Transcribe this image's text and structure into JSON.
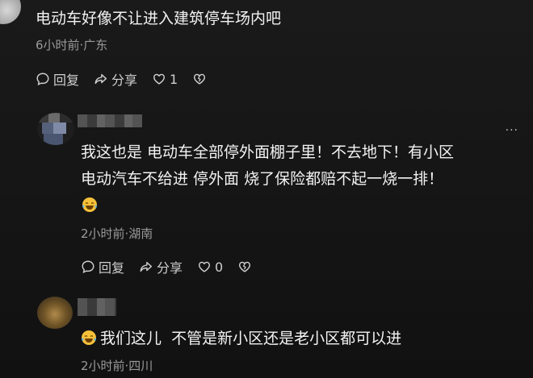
{
  "comment": {
    "text": "电动车好像不让进入建筑停车场内吧",
    "meta": "6小时前·广东",
    "reply_label": "回复",
    "share_label": "分享",
    "like_count": "1"
  },
  "reply1": {
    "line1": "我这也是 电动车全部停外面棚子里！不去地下！有小区",
    "line2": "电动汽车不给进 停外面 烧了保险都赔不起一烧一排！",
    "meta": "2小时前·湖南",
    "reply_label": "回复",
    "share_label": "分享",
    "like_count": "0",
    "menu": "···"
  },
  "reply2": {
    "text": "我们这儿  不管是新小区还是老小区都可以进",
    "meta": "2小时前·四川"
  },
  "icons": {
    "reply": "comment-bubble-icon",
    "share": "share-arrow-icon",
    "like": "heart-icon",
    "dislike": "broken-heart-icon",
    "emoji": "laughing-tears-emoji"
  }
}
